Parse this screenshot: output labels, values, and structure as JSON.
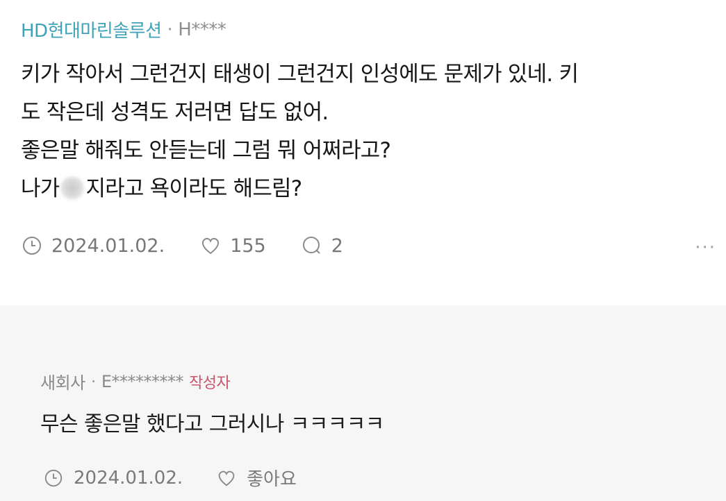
{
  "post": {
    "company": "HD현대마린솔루션",
    "separator": "·",
    "author": "H****",
    "lines": [
      "키가 작아서 그런건지 태생이 그런건지 인성에도 문제가 있네. 키",
      "도 작은데 성격도 저러면 답도 없어.",
      "좋은말 해줘도 안듣는데 그럼 뭐 어쩌라고?"
    ],
    "line4_before": "나가",
    "line4_after": "지라고 욕이라도 해드림?",
    "date": "2024.01.02.",
    "likes": "155",
    "comments": "2",
    "more": "···",
    "icons": {
      "clock": "clock-icon",
      "heart": "heart-icon",
      "comment": "comment-icon",
      "more": "more-icon"
    }
  },
  "reply": {
    "company": "새회사",
    "separator": "·",
    "author": "E*********",
    "badge": "작성자",
    "text": "무슨 좋은말 했다고 그러시나 ㅋㅋㅋㅋㅋ",
    "date": "2024.01.02.",
    "like_label": "좋아요"
  },
  "colors": {
    "company": "#3fa2b8",
    "badge": "#c9556a",
    "reply_bg": "#f6f6f6"
  }
}
